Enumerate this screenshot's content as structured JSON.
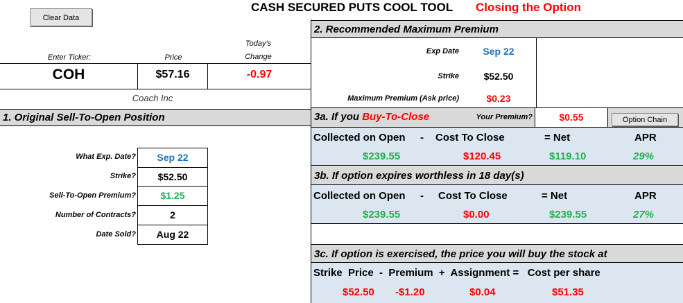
{
  "title": "CASH SECURED PUTS COOL TOOL",
  "subtitle": "Closing the Option",
  "clear_button": "Clear Data",
  "ticker": {
    "enter_label": "Enter Ticker:",
    "price_label": "Price",
    "change_label_1": "Today's",
    "change_label_2": "Change",
    "symbol": "COH",
    "price": "$57.16",
    "change": "-0.97",
    "company": "Coach Inc"
  },
  "section1": {
    "header": "1. Original Sell-To-Open Position",
    "rows": [
      {
        "label": "What Exp. Date?",
        "value": "Sep 22"
      },
      {
        "label": "Strike?",
        "value": "$52.50"
      },
      {
        "label": "Sell-To-Open Premium?",
        "value": "$1.25"
      },
      {
        "label": "Number of Contracts?",
        "value": "2"
      },
      {
        "label": "Date Sold?",
        "value": "Aug 22"
      }
    ]
  },
  "section2": {
    "header": "2. Recommended Maximum Premium",
    "exp_label": "Exp Date",
    "exp_value": "Sep 22",
    "strike_label": "Strike",
    "strike_value": "$52.50",
    "max_label": "Maximum Premium (Ask price)",
    "max_value": "$0.23"
  },
  "section3a": {
    "header_prefix": "3a. If you",
    "header_action": "Buy-To-Close",
    "your_premium_label": "Your Premium?",
    "your_premium_value": "$0.55",
    "option_chain_button": "Option Chain",
    "col1": "Collected on Open",
    "minus": "-",
    "col2": "Cost To Close",
    "col3": "= Net",
    "col4": "APR",
    "v1": "$239.55",
    "v2": "$120.45",
    "v3": "$119.10",
    "v4": "29%"
  },
  "section3b": {
    "header": "3b. If option expires worthless in 18 day(s)",
    "col1": "Collected on Open",
    "minus": "-",
    "col2": "Cost To Close",
    "col3": "= Net",
    "col4": "APR",
    "v1": "$239.55",
    "v2": "$0.00",
    "v3": "$239.55",
    "v4": "27%"
  },
  "section3c": {
    "header": "3c. If option is exercised, the price you will buy the stock at",
    "formula": "Strike  Price  -  Premium  +  Assignment =   Cost per share",
    "v1": "$52.50",
    "v2": "-$1.20",
    "v3": "$0.04",
    "v4": "$51.35"
  }
}
